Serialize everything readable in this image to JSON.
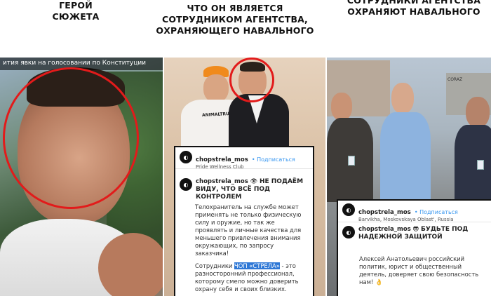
{
  "captions": {
    "left": [
      "ГЕРОЙ",
      "СЮЖЕТА"
    ],
    "center": [
      "ЧТО ОН ЯВЛЯЕТСЯ",
      "СОТРУДНИКОМ АГЕНТСТВА,",
      "ОХРАНЯЮЩЕГО НАВАЛЬНОГО"
    ],
    "right": [
      "СОТРУДНИКИ АГЕНТСТВА",
      "ОХРАНЯЮТ НАВАЛЬНОГО"
    ]
  },
  "left_panel": {
    "overlay_text": "ития явки на голосовании по Конституции"
  },
  "center_panel": {
    "shirt_text": "ANIMALTRU",
    "card1": {
      "handle": "chopstrela_mos",
      "follow": "• Подписаться",
      "location": "Pride Wellness Club",
      "headline_emoji": "👁",
      "headline": "НЕ ПОДАЁМ ВИДУ, ЧТО ВСЁ ПОД КОНТРОЛЕМ",
      "paragraph1": "Телохранитель на службе может применять не только физическую силу и оружие, но так же проявлять и личные качества для меньшего привлечения внимания окружающих, по запросу заказчика!",
      "p2_before": "Сотрудники ",
      "p2_highlight": "ЧОП «СТРЕЛА»",
      "p2_after": " - это разносторонний профессионал, которому смело можно доверить охрану себя и своих близких."
    }
  },
  "right_panel": {
    "sign_text": "CORAZ",
    "card2": {
      "handle": "chopstrela_mos",
      "follow": "• Подписаться",
      "location": "Barvikha, Moskovskaya Oblast', Russia",
      "headline_emoji": "😎",
      "headline": "БУДЬТЕ ПОД НАДЕЖНОЙ ЗАЩИТОЙ",
      "paragraph": "Алексей Анатольевич российский политик, юрист и общественный деятель, доверяет свою безопасность нам!",
      "emoji_end": "👌"
    }
  },
  "colors": {
    "accent_red": "#e21b1b",
    "highlight_blue": "#2f78d6",
    "follow_blue": "#3897f0"
  }
}
